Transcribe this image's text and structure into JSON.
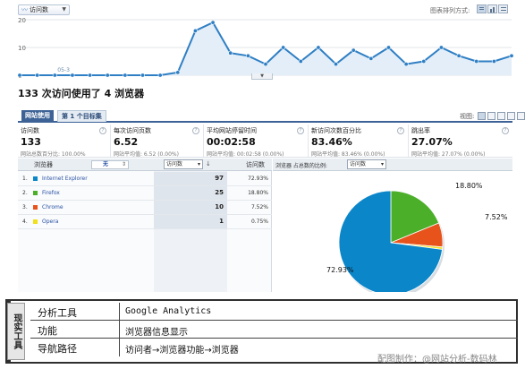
{
  "chart": {
    "metric_selector": "访问数",
    "view_mode_label": "图表排列方式:",
    "y_ticks": [
      "20",
      "10",
      "0"
    ],
    "x_labels": [
      "05-3",
      "05-10",
      "05-17",
      "05-24"
    ],
    "points": [
      {
        "date": "05-1",
        "visits": 0
      },
      {
        "date": "05-2",
        "visits": 0
      },
      {
        "date": "05-3",
        "visits": 0
      },
      {
        "date": "05-4",
        "visits": 0
      },
      {
        "date": "05-5",
        "visits": 0
      },
      {
        "date": "05-6",
        "visits": 0
      },
      {
        "date": "05-7",
        "visits": 0
      },
      {
        "date": "05-8",
        "visits": 0
      },
      {
        "date": "05-9",
        "visits": 0
      },
      {
        "date": "05-10",
        "visits": 1
      },
      {
        "date": "05-11",
        "visits": 16
      },
      {
        "date": "05-12",
        "visits": 19
      },
      {
        "date": "05-13",
        "visits": 8
      },
      {
        "date": "05-14",
        "visits": 7
      },
      {
        "date": "05-15",
        "visits": 4
      },
      {
        "date": "05-16",
        "visits": 10
      },
      {
        "date": "05-17",
        "visits": 5
      },
      {
        "date": "05-18",
        "visits": 10
      },
      {
        "date": "05-19",
        "visits": 4
      },
      {
        "date": "05-20",
        "visits": 9
      },
      {
        "date": "05-21",
        "visits": 6
      },
      {
        "date": "05-22",
        "visits": 10
      },
      {
        "date": "05-23",
        "visits": 4
      },
      {
        "date": "05-24",
        "visits": 5
      },
      {
        "date": "05-25",
        "visits": 10
      },
      {
        "date": "05-26",
        "visits": 7
      },
      {
        "date": "05-27",
        "visits": 5
      },
      {
        "date": "05-28",
        "visits": 5
      },
      {
        "date": "05-29",
        "visits": 7
      }
    ],
    "y_max": 20,
    "line_color": "#2f7fc4",
    "fill_color": "#e3eef8"
  },
  "heading": "133 次访问使用了 4 浏览器",
  "tabs": {
    "site_usage": "网站使用",
    "goal_set": "第 1 个目标集"
  },
  "views_label": "视图:",
  "summary": [
    {
      "label": "访问数",
      "value": "133",
      "note": "网站总数百分比: 100.00%"
    },
    {
      "label": "每次访问页数",
      "value": "6.52",
      "note": "网站平均值: 6.52 (0.00%)"
    },
    {
      "label": "平均网站停留时间",
      "value": "00:02:58",
      "note": "网站平均值: 00:02:58 (0.00%)"
    },
    {
      "label": "新访问次数百分比",
      "value": "83.46%",
      "note": "网站平均值: 83.46% (0.00%)"
    },
    {
      "label": "跳出率",
      "value": "27.07%",
      "note": "网站平均值: 27.07% (0.00%)"
    }
  ],
  "table": {
    "dimension_header": "浏览器",
    "secondary_dimension": "无",
    "sort_metric": "访问数",
    "metric_header": "访问数",
    "rows": [
      {
        "num": "1.",
        "name": "Internet Explorer",
        "value": "97",
        "pct": "72.93%",
        "color": "#0b86c9"
      },
      {
        "num": "2.",
        "name": "Firefox",
        "value": "25",
        "pct": "18.80%",
        "color": "#4caf2a"
      },
      {
        "num": "3.",
        "name": "Chrome",
        "value": "10",
        "pct": "7.52%",
        "color": "#e8531c"
      },
      {
        "num": "4.",
        "name": "Opera",
        "value": "1",
        "pct": "0.75%",
        "color": "#f1e01a"
      }
    ]
  },
  "pie": {
    "header_label": "浏览器 占总数的比例:",
    "metric": "访问数",
    "labels": [
      "72.93%",
      "18.80%",
      "7.52%"
    ]
  },
  "info": {
    "side_title": "现实工具",
    "rows": [
      {
        "key": "分析工具",
        "value": "Google Analytics"
      },
      {
        "key": "功能",
        "value": "浏览器信息显示"
      },
      {
        "key": "导航路径",
        "value": "访问者→浏览器功能→浏览器"
      }
    ]
  },
  "watermark": "配图制作：@网站分析-数码林"
}
